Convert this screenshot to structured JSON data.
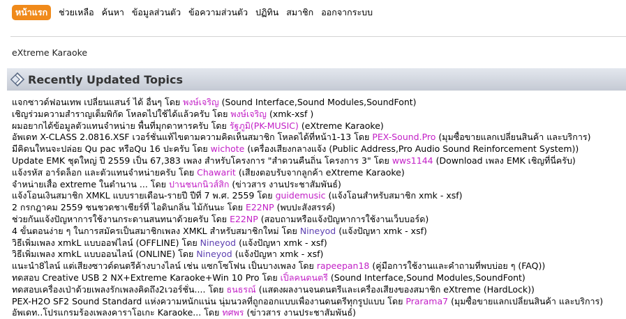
{
  "nav": {
    "items": [
      "หน้าแรก",
      "ช่วยเหลือ",
      "ค้นหา",
      "ข้อมูลส่วนตัว",
      "ข้อความส่วนตัว",
      "ปฏิทิน",
      "สมาชิก",
      "ออกจากระบบ"
    ],
    "active_index": 0,
    "active_color": "#f08a1a"
  },
  "forum_name": "eXtreme Karaoke",
  "section": {
    "title": "Recently Updated Topics",
    "icon": "diamond-topic-icon"
  },
  "by_word": "โดย",
  "topics": [
    {
      "title": "แจกซาวด์ฟอนเทพ เปลี่ยนแสนร์ ได้ อื่นๆ",
      "author": "พงษ์เจริญ",
      "author_color": "magenta",
      "forum": "(Sound Interface,Sound Modules,SoundFont)"
    },
    {
      "title": "เชิญร่วมความสำราญเต็มพิกัด โหลดไปใช้ได้แล้วครับ",
      "author": "พงษ์เจริญ",
      "author_color": "magenta",
      "forum": "(xmk-xsf )"
    },
    {
      "title": "ผมอยากได้ข้อมูลตัวแทนจำหน่าย พื้นที่มุกดาหารครับ",
      "author": "รัฐภูมิ(PK-MUSIC)",
      "author_color": "magenta",
      "forum": "(eXtreme Karaoke)"
    },
    {
      "title": "อัพเดท X-CLASS 2.0816.XSF เวอร์ชั่นแท้ไขตามความคิดเห็นสมาชิก โหลดได้ที่หน้า1-13",
      "author": "PEX-Sound.Pro",
      "author_color": "magenta",
      "forum": "(มุมซื้อขายแลกเปลี่ยนสินค้า และบริการ)"
    },
    {
      "title": "มีคิดนใหนจะปล่อย Qu pac หรือQu 16 ปะครับ",
      "author": "wichote",
      "author_color": "magenta",
      "forum": "(เครื่องเสียงกลางแจ้ง (Public Address,Pro Audio Sound Reinforcement System))"
    },
    {
      "title": "Update EMK ชุดใหญ่ ปี 2559 เป็น 67,383 เพลง สำหรับโครงการ \"สำดวนคืนถิ่น โครงการ 3\"",
      "author": "wws1144",
      "author_color": "magenta",
      "forum": "(Download เพลง EMK เชิญที่นี่ครับ)"
    },
    {
      "title": "แจ้งรหัส อาร์ดล็อก และตัวแทนจำหน่ายครับ",
      "author": "Chawarit",
      "author_color": "magenta",
      "forum": "(เสียงตอบรับจากลูกค้า eXtreme Karaoke)"
    },
    {
      "title": "จำหน่ายเสื้อ extreme ในตำนาน ...",
      "author": "ปานชนกนิวส์สิก",
      "author_color": "magenta",
      "forum": "(ข่าวสาร งานประชาสัมพันธ์)"
    },
    {
      "title": "แจ้งโอนเงินสมาชิก XMKL แบบรายเดือน-รายปี ปีที่ 7 พ.ศ. 2559",
      "author": "guidemusic",
      "author_color": "magenta",
      "forum": "(แจ้งโอนสำหรับสมาชิก xmk - xsf)"
    },
    {
      "title": "2 กรกฎาคม 2559 ชนชวดชาเชียร์ที่ ไอดินกลิ่น ไม้กันนะ",
      "author": "E22NP",
      "author_color": "magenta",
      "forum": "(พบปะสังสรรค์)"
    },
    {
      "title": "ช่วยกันแจ้งปัญหาการใช้งานกระดานสนทนาด้วยครับ",
      "author": "E22NP",
      "author_color": "magenta",
      "forum": "(สอบถามหรือแจ้งปัญหาการใช้งานเว็บบอร์ด)"
    },
    {
      "title": "4 ขั้นตอนง่าย ๆ ในการสมัครเป็นสมาชิกเพลง XMKL สำหรับสมาชิกใหม่",
      "author": "Nineyod",
      "author_color": "blue",
      "forum": "(แจ้งปัญหา xmk - xsf)"
    },
    {
      "title": "วิธีเพิ่มเพลง xmkL แบบออฟไลน์ (OFFLINE)",
      "author": "Nineyod",
      "author_color": "blue",
      "forum": "(แจ้งปัญหา xmk - xsf)"
    },
    {
      "title": "วิธีเพิ่มเพลง xmkL แบบออนไลน์ (ONLINE)",
      "author": "Nineyod",
      "author_color": "blue",
      "forum": "(แจ้งปัญหา xmk - xsf)"
    },
    {
      "title": "แนะนำ8ไลน์ แต่เสียงซาวด์ดนตรีค้างบางไลน์ เช่น แซกโซโฟน เป็นบางเพลง",
      "author": "rapeepan18",
      "author_color": "magenta",
      "forum": "(คู่มือการใช้งานและคำถามที่พบบ่อย ๆ (FAQ))"
    },
    {
      "title": "ทดสอบ Creative USB 2 NX+Extreme Karaoke+Win 10 Pro",
      "author": "เปิ้ลคนดนตรี",
      "author_color": "magenta",
      "forum": "(Sound Interface,Sound Modules,SoundFont)"
    },
    {
      "title": "ทดสอบเครื่องเป่าด้วยเพลงรักเพลงคิดถึง2เวอร์ชั่น....",
      "author": "ธนธรณ์",
      "author_color": "magenta",
      "forum": "(แสดงผลงานจนดนตรีและเครื่องเสียงของสมาชิก eXtreme (HardLock))"
    },
    {
      "title": "PEX-H2O SF2 Sound Standard แห่งความหนักแน่น นุ่มนวลที่ถูกออกแบบเพื่องานดนตรีทุกรูปแบบ",
      "author": "Prarama7",
      "author_color": "magenta",
      "forum": "(มุมซื้อขายแลกเปลี่ยนสินค้า และบริการ)"
    },
    {
      "title": "อัพเดท..โปรแกรมร้องเพลงคาราโอเกะ Karaoke...",
      "author": "ทศพร",
      "author_color": "magenta",
      "forum": "(ข่าวสาร งานประชาสัมพันธ์)"
    }
  ]
}
